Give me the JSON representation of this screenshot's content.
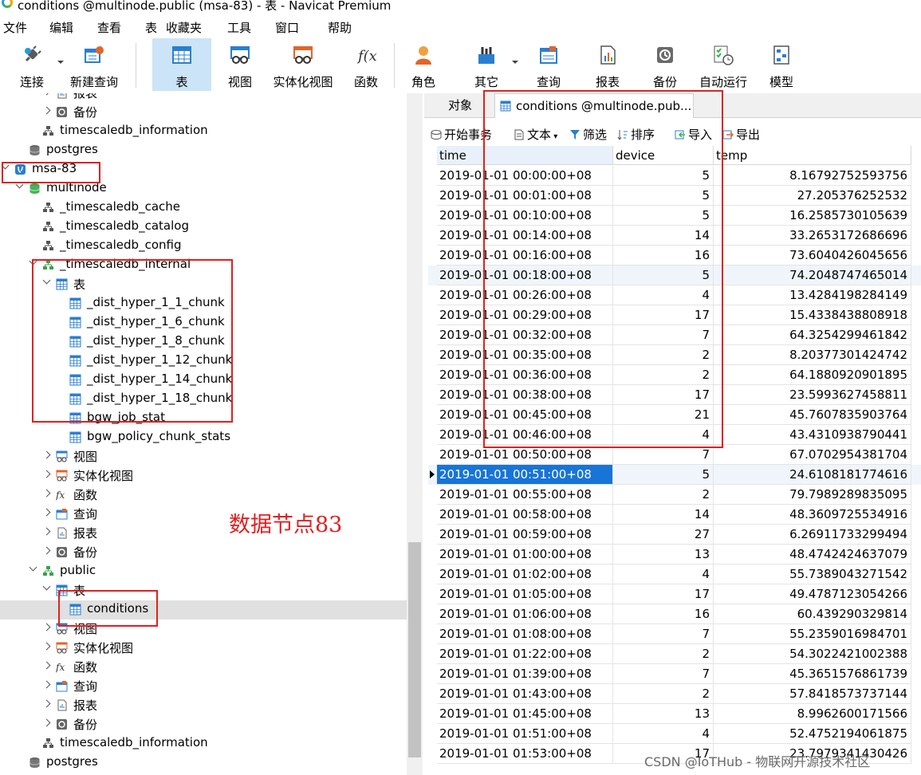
{
  "window": {
    "title": "conditions @multinode.public (msa-83) - 表 - Navicat Premium"
  },
  "menu": [
    "文件",
    "编辑",
    "查看",
    "表",
    "收藏夹",
    "工具",
    "窗口",
    "帮助"
  ],
  "toolbar": [
    {
      "label": "连接",
      "icon": "plug-icon"
    },
    {
      "label": "新建查询",
      "icon": "new-query-icon"
    },
    {
      "label": "表",
      "icon": "table-icon"
    },
    {
      "label": "视图",
      "icon": "view-icon"
    },
    {
      "label": "实体化视图",
      "icon": "materialized-view-icon"
    },
    {
      "label": "函数",
      "icon": "function-icon"
    },
    {
      "label": "角色",
      "icon": "user-icon"
    },
    {
      "label": "其它",
      "icon": "tools-icon"
    },
    {
      "label": "查询",
      "icon": "query-icon"
    },
    {
      "label": "报表",
      "icon": "report-icon"
    },
    {
      "label": "备份",
      "icon": "backup-icon"
    },
    {
      "label": "自动运行",
      "icon": "schedule-icon"
    },
    {
      "label": "模型",
      "icon": "model-icon"
    }
  ],
  "tree": [
    {
      "label": "报表",
      "icon": "report-icon"
    },
    {
      "label": "备份",
      "icon": "backup-icon"
    },
    {
      "label": "timescaledb_information",
      "icon": "schema-icon"
    },
    {
      "label": "postgres",
      "icon": "database-icon"
    },
    {
      "label": "msa-83",
      "icon": "postgres-connection-icon"
    },
    {
      "label": "multinode",
      "icon": "database-icon"
    },
    {
      "label": "_timescaledb_cache",
      "icon": "schema-icon"
    },
    {
      "label": "_timescaledb_catalog",
      "icon": "schema-icon"
    },
    {
      "label": "_timescaledb_config",
      "icon": "schema-icon"
    },
    {
      "label": "_timescaledb_internal",
      "icon": "schema-icon"
    },
    {
      "label": "表",
      "icon": "table-icon"
    },
    {
      "label": "_dist_hyper_1_1_chunk",
      "icon": "table-icon"
    },
    {
      "label": "_dist_hyper_1_6_chunk",
      "icon": "table-icon"
    },
    {
      "label": "_dist_hyper_1_8_chunk",
      "icon": "table-icon"
    },
    {
      "label": "_dist_hyper_1_12_chunk",
      "icon": "table-icon"
    },
    {
      "label": "_dist_hyper_1_14_chunk",
      "icon": "table-icon"
    },
    {
      "label": "_dist_hyper_1_18_chunk",
      "icon": "table-icon"
    },
    {
      "label": "bgw_job_stat",
      "icon": "table-icon"
    },
    {
      "label": "bgw_policy_chunk_stats",
      "icon": "table-icon"
    },
    {
      "label": "视图",
      "icon": "view-icon"
    },
    {
      "label": "实体化视图",
      "icon": "materialized-view-icon"
    },
    {
      "label": "函数",
      "icon": "function-icon"
    },
    {
      "label": "查询",
      "icon": "query-icon"
    },
    {
      "label": "报表",
      "icon": "report-icon"
    },
    {
      "label": "备份",
      "icon": "backup-icon"
    },
    {
      "label": "public",
      "icon": "schema-icon"
    },
    {
      "label": "表",
      "icon": "table-icon"
    },
    {
      "label": "conditions",
      "icon": "table-icon"
    },
    {
      "label": "视图",
      "icon": "view-icon"
    },
    {
      "label": "实体化视图",
      "icon": "materialized-view-icon"
    },
    {
      "label": "函数",
      "icon": "function-icon"
    },
    {
      "label": "查询",
      "icon": "query-icon"
    },
    {
      "label": "报表",
      "icon": "report-icon"
    },
    {
      "label": "备份",
      "icon": "backup-icon"
    },
    {
      "label": "timescaledb_information",
      "icon": "schema-icon"
    },
    {
      "label": "postgres",
      "icon": "database-icon"
    }
  ],
  "tabs": [
    "对象",
    "conditions @multinode.pub..."
  ],
  "data_toolbar": {
    "begin_tx": "开始事务",
    "text": "文本",
    "filter": "筛选",
    "sort": "排序",
    "import": "导入",
    "export": "导出"
  },
  "grid": {
    "headers": [
      "time",
      "device",
      "temp"
    ],
    "rows": [
      [
        "2019-01-01 00:00:00+08",
        "5",
        "8.16792752593756"
      ],
      [
        "2019-01-01 00:01:00+08",
        "5",
        "27.205376252532"
      ],
      [
        "2019-01-01 00:10:00+08",
        "5",
        "16.2585730105639"
      ],
      [
        "2019-01-01 00:14:00+08",
        "14",
        "33.2653172686696"
      ],
      [
        "2019-01-01 00:16:00+08",
        "16",
        "73.6040426045656"
      ],
      [
        "2019-01-01 00:18:00+08",
        "5",
        "74.2048747465014"
      ],
      [
        "2019-01-01 00:26:00+08",
        "4",
        "13.4284198284149"
      ],
      [
        "2019-01-01 00:29:00+08",
        "17",
        "15.4338438808918"
      ],
      [
        "2019-01-01 00:32:00+08",
        "7",
        "64.3254299461842"
      ],
      [
        "2019-01-01 00:35:00+08",
        "2",
        "8.20377301424742"
      ],
      [
        "2019-01-01 00:36:00+08",
        "2",
        "64.1880920901895"
      ],
      [
        "2019-01-01 00:38:00+08",
        "17",
        "23.5993627458811"
      ],
      [
        "2019-01-01 00:45:00+08",
        "21",
        "45.7607835903764"
      ],
      [
        "2019-01-01 00:46:00+08",
        "4",
        "43.4310938790441"
      ],
      [
        "2019-01-01 00:50:00+08",
        "7",
        "67.0702954381704"
      ],
      [
        "2019-01-01 00:51:00+08",
        "5",
        "24.6108181774616"
      ],
      [
        "2019-01-01 00:55:00+08",
        "2",
        "79.7989289835095"
      ],
      [
        "2019-01-01 00:58:00+08",
        "14",
        "48.3609725534916"
      ],
      [
        "2019-01-01 00:59:00+08",
        "27",
        "6.26911733299494"
      ],
      [
        "2019-01-01 01:00:00+08",
        "13",
        "48.4742424637079"
      ],
      [
        "2019-01-01 01:02:00+08",
        "4",
        "55.7389043271542"
      ],
      [
        "2019-01-01 01:05:00+08",
        "17",
        "49.4787123054266"
      ],
      [
        "2019-01-01 01:06:00+08",
        "16",
        "60.439290329814"
      ],
      [
        "2019-01-01 01:08:00+08",
        "7",
        "55.2359016984701"
      ],
      [
        "2019-01-01 01:22:00+08",
        "2",
        "54.3022421002388"
      ],
      [
        "2019-01-01 01:39:00+08",
        "7",
        "45.3651576861739"
      ],
      [
        "2019-01-01 01:43:00+08",
        "2",
        "57.8418573737144"
      ],
      [
        "2019-01-01 01:45:00+08",
        "13",
        "8.9962600171566"
      ],
      [
        "2019-01-01 01:51:00+08",
        "4",
        "52.4752194061875"
      ],
      [
        "2019-01-01 01:53:00+08",
        "17",
        "23.7979341430426"
      ]
    ]
  },
  "annotation": "数据节点83",
  "watermark": "CSDN @IoTHub - 物联网开源技术社区",
  "colors": {
    "selection": "#1874d6",
    "annotation": "#e02020",
    "toolbar_active": "#cce4f7"
  }
}
